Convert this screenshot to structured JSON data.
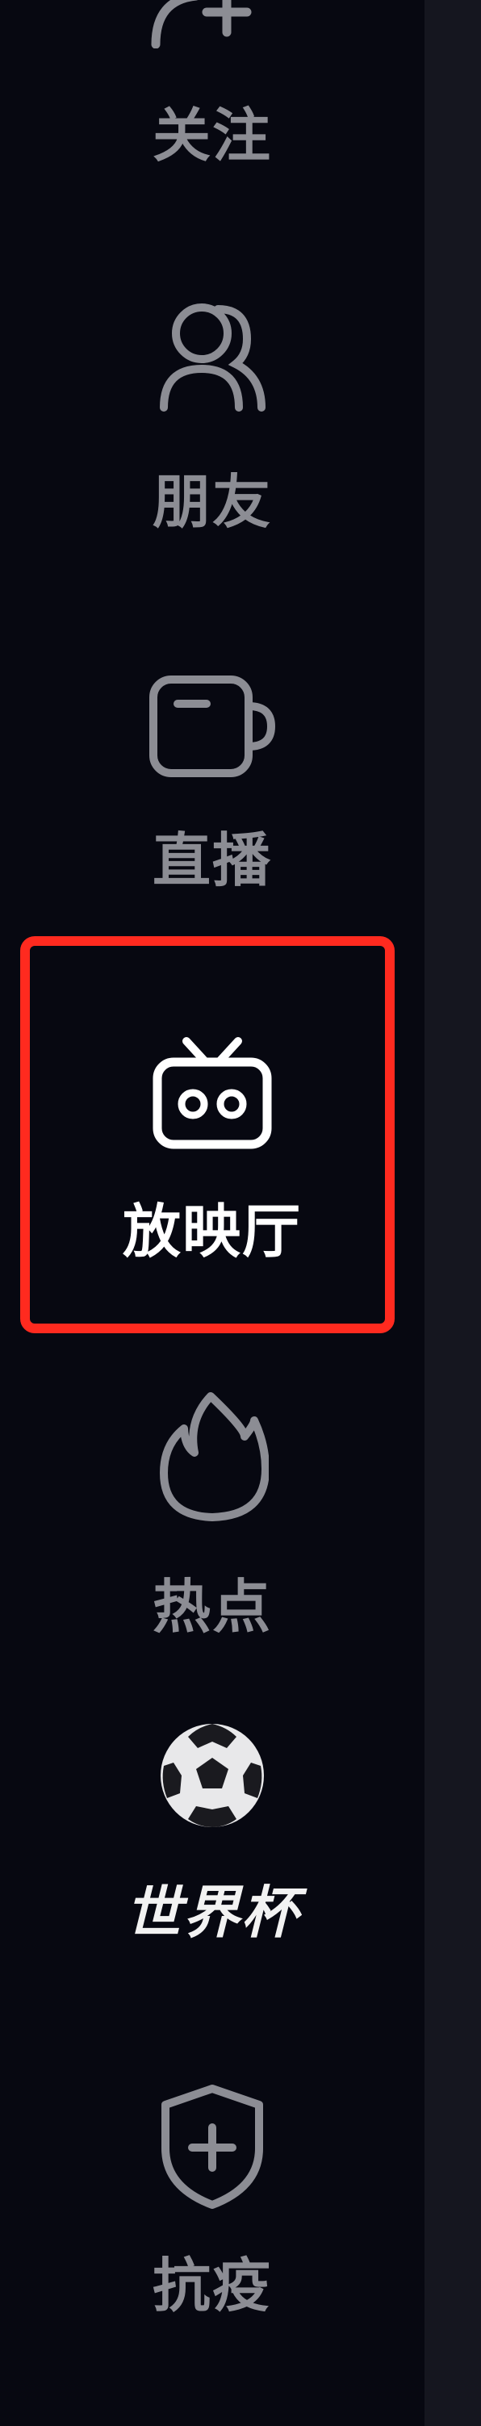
{
  "sidebar": {
    "items": [
      {
        "id": "follow",
        "label": "关注",
        "icon": "follow-plus-icon"
      },
      {
        "id": "friends",
        "label": "朋友",
        "icon": "friends-icon"
      },
      {
        "id": "live",
        "label": "直播",
        "icon": "live-icon"
      },
      {
        "id": "cinema",
        "label": "放映厅",
        "icon": "tv-icon",
        "active": true
      },
      {
        "id": "hot",
        "label": "热点",
        "icon": "flame-icon"
      },
      {
        "id": "worldcup",
        "label": "世界杯",
        "icon": "soccer-ball-icon"
      },
      {
        "id": "antiepidemic",
        "label": "抗疫",
        "icon": "shield-plus-icon"
      }
    ]
  },
  "colors": {
    "background": "#070811",
    "inactive": "#8c8d94",
    "active": "#ffffff",
    "highlight": "#ff2a1f"
  }
}
